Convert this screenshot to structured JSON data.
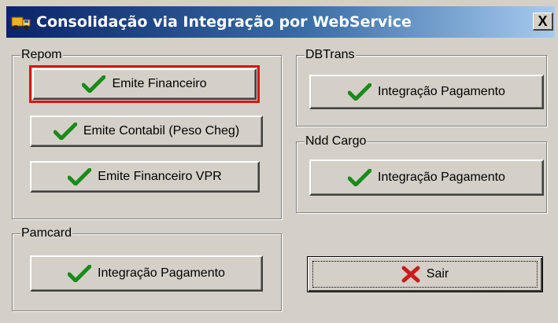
{
  "window": {
    "title": "Consolidação via Integração por WebService",
    "close_label": "X"
  },
  "groups": {
    "repom": {
      "label": "Repom",
      "buttons": [
        "Emite Financeiro",
        "Emite Contabil (Peso Cheg)",
        "Emite Financeiro VPR"
      ]
    },
    "dbtrans": {
      "label": "DBTrans",
      "button": "Integração Pagamento"
    },
    "nddcargo": {
      "label": "Ndd Cargo",
      "button": "Integração Pagamento"
    },
    "pamcard": {
      "label": "Pamcard",
      "button": "Integração Pagamento"
    }
  },
  "actions": {
    "exit_label": "Sair"
  },
  "icons": {
    "confirm": "green-check-icon",
    "exit": "red-x-icon",
    "app": "truck-icon"
  },
  "colors": {
    "check": "#1a8a1a",
    "x": "#cc1a1a",
    "highlight": "#e01010"
  }
}
